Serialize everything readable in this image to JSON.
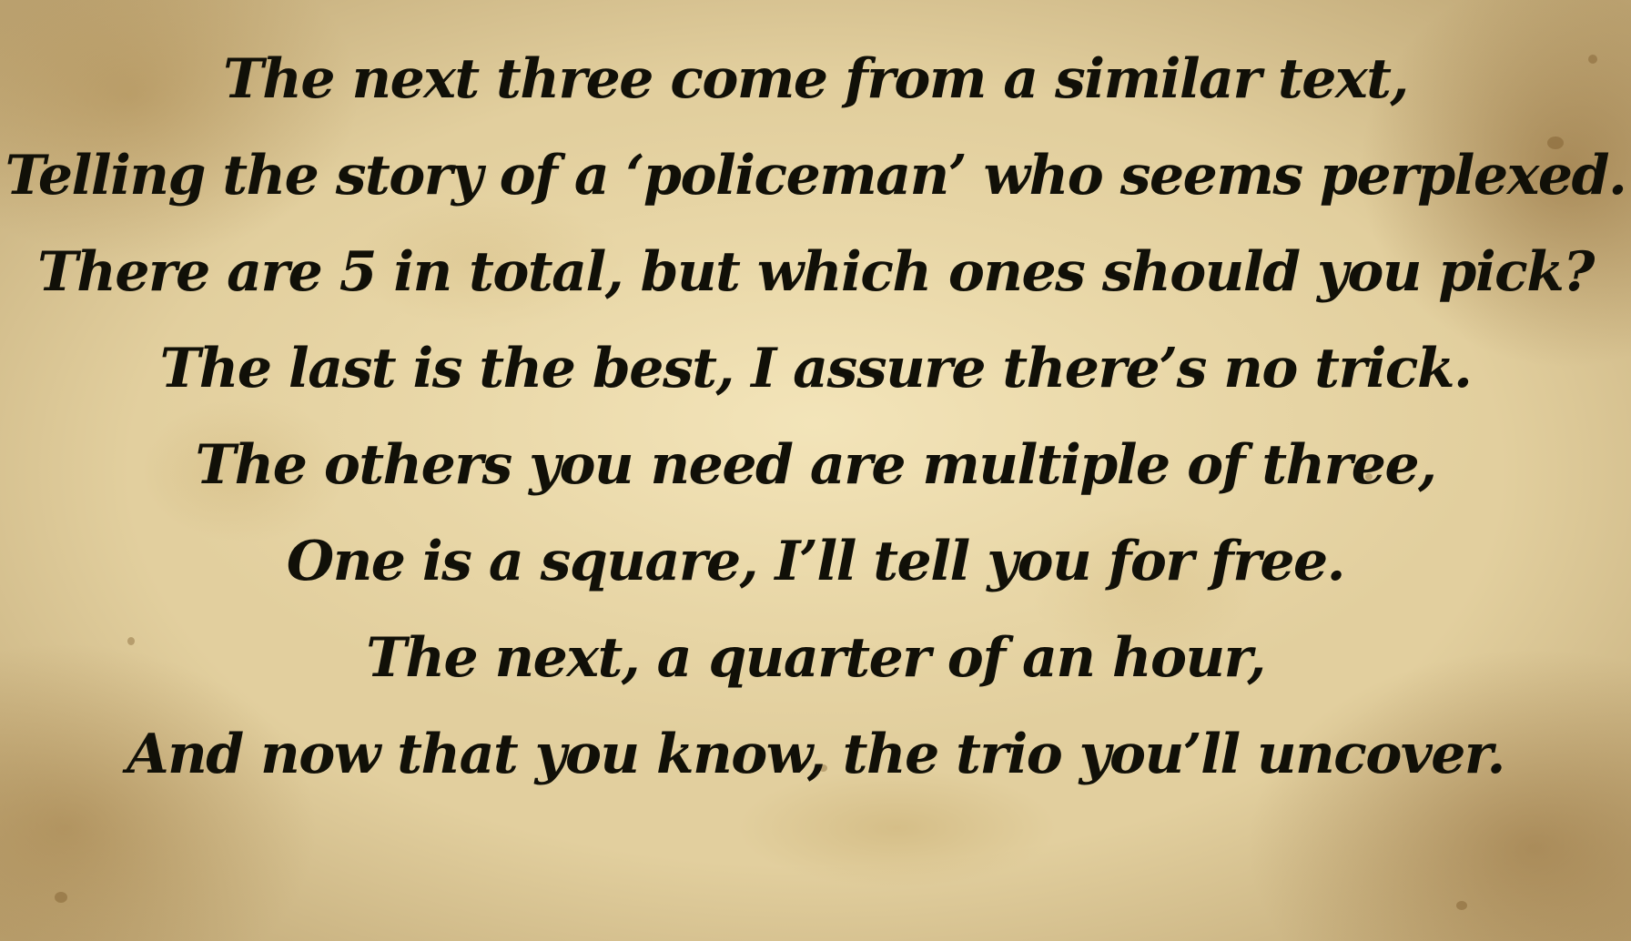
{
  "poem": {
    "lines": [
      "The next three come from a similar text,",
      "Telling the story of a ‘policeman’ who seems perplexed.",
      "There are 5 in total, but which ones should you pick?",
      "The last is the best, I assure there’s no trick.",
      "The others you need are multiple of three,",
      "One is a square, I’ll tell you for free.",
      "The next, a quarter of an hour,",
      "And now that you know, the trio you’ll uncover."
    ]
  },
  "colors": {
    "text": "#111008",
    "parchment": "#e2cf9e"
  }
}
